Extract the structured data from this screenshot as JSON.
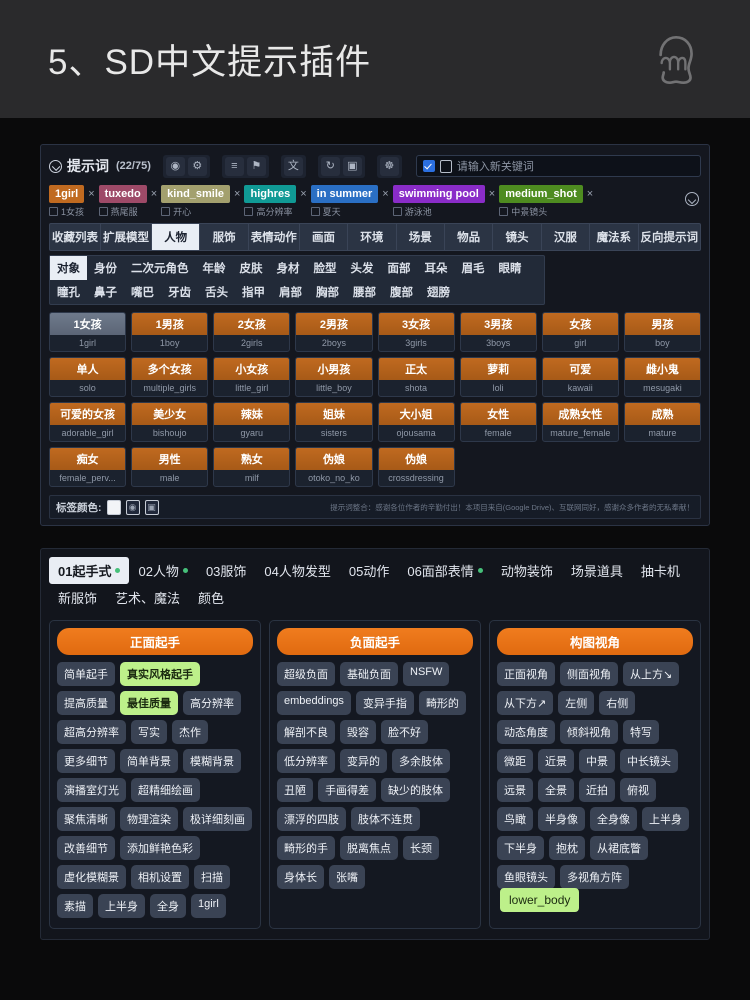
{
  "header": {
    "title": "5、SD中文提示插件",
    "hand_icon": "pointing-hand-icon"
  },
  "panel1": {
    "title": "提示词",
    "count": "(22/75)",
    "chevron_icon": "chevron-down-circle-icon",
    "toolbar_icons": [
      {
        "name": "globe-icon",
        "glyph": "⊕"
      },
      {
        "name": "gear-icon",
        "glyph": "⚙"
      },
      {
        "name": "list-doc-icon",
        "glyph": "≣"
      },
      {
        "name": "bookmark-icon",
        "glyph": "⚑"
      },
      {
        "name": "translate-icon",
        "glyph": "文"
      },
      {
        "name": "refresh-icon",
        "glyph": "↻"
      },
      {
        "name": "trash-icon",
        "glyph": "Ὕ1"
      },
      {
        "name": "settings-icon",
        "glyph": "☸"
      }
    ],
    "search": {
      "checkbox_checked": true,
      "placeholder": "请输入新关键词"
    },
    "chips": [
      {
        "en": "1girl",
        "cn": "1女孩",
        "color": "#c06a20",
        "close": "×"
      },
      {
        "en": "tuxedo",
        "cn": "燕尾服",
        "color": "#9e4a68",
        "close": "×"
      },
      {
        "en": "kind_smile",
        "cn": "开心",
        "color": "#a3a06e",
        "close": "×"
      },
      {
        "en": "highres",
        "cn": "高分辨率",
        "color": "#109a95",
        "close": "×"
      },
      {
        "en": "in summer",
        "cn": "夏天",
        "color": "#2a6fc4",
        "close": "×"
      },
      {
        "en": "swimming pool",
        "cn": "游泳池",
        "color": "#8a2cc8",
        "close": "×"
      },
      {
        "en": "medium_shot",
        "cn": "中景镜头",
        "color": "#4e8c20",
        "close": "×"
      }
    ],
    "category_tabs": [
      {
        "label": "收藏列表",
        "active": false
      },
      {
        "label": "扩展模型",
        "active": false
      },
      {
        "label": "人物",
        "active": true
      },
      {
        "label": "服饰",
        "active": false
      },
      {
        "label": "表情动作",
        "active": false
      },
      {
        "label": "画面",
        "active": false
      },
      {
        "label": "环境",
        "active": false
      },
      {
        "label": "场景",
        "active": false
      },
      {
        "label": "物品",
        "active": false
      },
      {
        "label": "镜头",
        "active": false
      },
      {
        "label": "汉服",
        "active": false
      },
      {
        "label": "魔法系",
        "active": false
      },
      {
        "label": "反向提示词",
        "active": false
      }
    ],
    "sub_tabs": [
      {
        "label": "对象",
        "active": true
      },
      {
        "label": "身份",
        "active": false
      },
      {
        "label": "二次元角色",
        "active": false
      },
      {
        "label": "年龄",
        "active": false
      },
      {
        "label": "皮肤",
        "active": false
      },
      {
        "label": "身材",
        "active": false
      },
      {
        "label": "脸型",
        "active": false
      },
      {
        "label": "头发",
        "active": false
      },
      {
        "label": "面部",
        "active": false
      },
      {
        "label": "耳朵",
        "active": false
      },
      {
        "label": "眉毛",
        "active": false
      },
      {
        "label": "眼睛",
        "active": false
      },
      {
        "label": "瞳孔",
        "active": false
      },
      {
        "label": "鼻子",
        "active": false
      },
      {
        "label": "嘴巴",
        "active": false
      },
      {
        "label": "牙齿",
        "active": false
      },
      {
        "label": "舌头",
        "active": false
      },
      {
        "label": "指甲",
        "active": false
      },
      {
        "label": "肩部",
        "active": false
      },
      {
        "label": "胸部",
        "active": false
      },
      {
        "label": "腰部",
        "active": false
      },
      {
        "label": "腹部",
        "active": false
      },
      {
        "label": "翅膀",
        "active": false
      }
    ],
    "tags": [
      {
        "cn": "1女孩",
        "en": "1girl",
        "selected": true
      },
      {
        "cn": "1男孩",
        "en": "1boy",
        "selected": false
      },
      {
        "cn": "2女孩",
        "en": "2girls",
        "selected": false
      },
      {
        "cn": "2男孩",
        "en": "2boys",
        "selected": false
      },
      {
        "cn": "3女孩",
        "en": "3girls",
        "selected": false
      },
      {
        "cn": "3男孩",
        "en": "3boys",
        "selected": false
      },
      {
        "cn": "女孩",
        "en": "girl",
        "selected": false
      },
      {
        "cn": "男孩",
        "en": "boy",
        "selected": false
      },
      {
        "cn": "单人",
        "en": "solo",
        "selected": false
      },
      {
        "cn": "多个女孩",
        "en": "multiple_girls",
        "selected": false
      },
      {
        "cn": "小女孩",
        "en": "little_girl",
        "selected": false
      },
      {
        "cn": "小男孩",
        "en": "little_boy",
        "selected": false
      },
      {
        "cn": "正太",
        "en": "shota",
        "selected": false
      },
      {
        "cn": "萝莉",
        "en": "loli",
        "selected": false
      },
      {
        "cn": "可爱",
        "en": "kawaii",
        "selected": false
      },
      {
        "cn": "雌小鬼",
        "en": "mesugaki",
        "selected": false
      },
      {
        "cn": "可爱的女孩",
        "en": "adorable_girl",
        "selected": false
      },
      {
        "cn": "美少女",
        "en": "bishoujo",
        "selected": false
      },
      {
        "cn": "辣妹",
        "en": "gyaru",
        "selected": false
      },
      {
        "cn": "姐妹",
        "en": "sisters",
        "selected": false
      },
      {
        "cn": "大小姐",
        "en": "ojousama",
        "selected": false
      },
      {
        "cn": "女性",
        "en": "female",
        "selected": false
      },
      {
        "cn": "成熟女性",
        "en": "mature_female",
        "selected": false
      },
      {
        "cn": "成熟",
        "en": "mature",
        "selected": false
      },
      {
        "cn": "痴女",
        "en": "female_perv...",
        "selected": false
      },
      {
        "cn": "男性",
        "en": "male",
        "selected": false
      },
      {
        "cn": "熟女",
        "en": "milf",
        "selected": false
      },
      {
        "cn": "伪娘",
        "en": "otoko_no_ko",
        "selected": false
      },
      {
        "cn": "伪娘",
        "en": "crossdressing",
        "selected": false
      }
    ],
    "footer": {
      "label": "标签颜色:",
      "swatches": [
        "white-swatch",
        "reset-swatch",
        "lock-swatch"
      ],
      "note": "提示词整合：感谢各位作者的辛勤付出！本项目来自(Google Drive)、互联网同好，感谢众多作者的无私奉献！"
    }
  },
  "panel2": {
    "tabs": [
      {
        "label": "01起手式",
        "active": true,
        "dot": true
      },
      {
        "label": "02人物",
        "active": false,
        "dot": true
      },
      {
        "label": "03服饰",
        "active": false,
        "dot": false
      },
      {
        "label": "04人物发型",
        "active": false,
        "dot": false
      },
      {
        "label": "05动作",
        "active": false,
        "dot": false
      },
      {
        "label": "06面部表情",
        "active": false,
        "dot": true
      },
      {
        "label": "动物装饰",
        "active": false,
        "dot": false
      },
      {
        "label": "场景道具",
        "active": false,
        "dot": false
      },
      {
        "label": "抽卡机",
        "active": false,
        "dot": false
      },
      {
        "label": "新服饰",
        "active": false,
        "dot": false
      },
      {
        "label": "艺术、魔法",
        "active": false,
        "dot": false
      },
      {
        "label": "颜色",
        "active": false,
        "dot": false
      }
    ],
    "columns": [
      {
        "header": "正面起手",
        "items": [
          {
            "label": "简单起手",
            "highlight": false
          },
          {
            "label": "真实风格起手",
            "highlight": true
          },
          {
            "label": "提高质量",
            "highlight": false
          },
          {
            "label": "最佳质量",
            "highlight": true
          },
          {
            "label": "高分辨率",
            "highlight": false
          },
          {
            "label": "超高分辨率",
            "highlight": false
          },
          {
            "label": "写实",
            "highlight": false
          },
          {
            "label": "杰作",
            "highlight": false
          },
          {
            "label": "更多细节",
            "highlight": false
          },
          {
            "label": "简单背景",
            "highlight": false
          },
          {
            "label": "模糊背景",
            "highlight": false
          },
          {
            "label": "演播室灯光",
            "highlight": false
          },
          {
            "label": "超精细绘画",
            "highlight": false
          },
          {
            "label": "聚焦清晰",
            "highlight": false
          },
          {
            "label": "物理渲染",
            "highlight": false
          },
          {
            "label": "极详细刻画",
            "highlight": false
          },
          {
            "label": "改善细节",
            "highlight": false
          },
          {
            "label": "添加鲜艳色彩",
            "highlight": false
          },
          {
            "label": "虚化模糊景",
            "highlight": false
          },
          {
            "label": "相机设置",
            "highlight": false
          },
          {
            "label": "扫描",
            "highlight": false
          },
          {
            "label": "素描",
            "highlight": false
          },
          {
            "label": "上半身",
            "highlight": false
          },
          {
            "label": "全身",
            "highlight": false
          },
          {
            "label": "1girl",
            "highlight": false
          }
        ]
      },
      {
        "header": "负面起手",
        "items": [
          {
            "label": "超级负面",
            "highlight": false
          },
          {
            "label": "基础负面",
            "highlight": false
          },
          {
            "label": "NSFW",
            "highlight": false
          },
          {
            "label": "embeddings",
            "highlight": false
          },
          {
            "label": "变异手指",
            "highlight": false
          },
          {
            "label": "畸形的",
            "highlight": false
          },
          {
            "label": "解剖不良",
            "highlight": false
          },
          {
            "label": "毁容",
            "highlight": false
          },
          {
            "label": "脸不好",
            "highlight": false
          },
          {
            "label": "低分辨率",
            "highlight": false
          },
          {
            "label": "变异的",
            "highlight": false
          },
          {
            "label": "多余肢体",
            "highlight": false
          },
          {
            "label": "丑陋",
            "highlight": false
          },
          {
            "label": "手画得差",
            "highlight": false
          },
          {
            "label": "缺少的肢体",
            "highlight": false
          },
          {
            "label": "漂浮的四肢",
            "highlight": false
          },
          {
            "label": "肢体不连贯",
            "highlight": false
          },
          {
            "label": "畸形的手",
            "highlight": false
          },
          {
            "label": "脱离焦点",
            "highlight": false
          },
          {
            "label": "长颈",
            "highlight": false
          },
          {
            "label": "身体长",
            "highlight": false
          },
          {
            "label": "张嘴",
            "highlight": false
          }
        ]
      },
      {
        "header": "构图视角",
        "items": [
          {
            "label": "正面视角",
            "highlight": false
          },
          {
            "label": "侧面视角",
            "highlight": false
          },
          {
            "label": "从上方↘",
            "highlight": false
          },
          {
            "label": "从下方↗",
            "highlight": false
          },
          {
            "label": "左侧",
            "highlight": false
          },
          {
            "label": "右侧",
            "highlight": false
          },
          {
            "label": "动态角度",
            "highlight": false
          },
          {
            "label": "倾斜视角",
            "highlight": false
          },
          {
            "label": "特写",
            "highlight": false
          },
          {
            "label": "微距",
            "highlight": false
          },
          {
            "label": "近景",
            "highlight": false
          },
          {
            "label": "中景",
            "highlight": false
          },
          {
            "label": "中长镜头",
            "highlight": false
          },
          {
            "label": "远景",
            "highlight": false
          },
          {
            "label": "全景",
            "highlight": false
          },
          {
            "label": "近拍",
            "highlight": false
          },
          {
            "label": "俯视",
            "highlight": false
          },
          {
            "label": "鸟瞰",
            "highlight": false
          },
          {
            "label": "半身像",
            "highlight": false
          },
          {
            "label": "全身像",
            "highlight": false
          },
          {
            "label": "上半身",
            "highlight": false
          },
          {
            "label": "下半身",
            "highlight": false
          },
          {
            "label": "抱枕",
            "highlight": false
          },
          {
            "label": "从裙底瞥",
            "highlight": false
          },
          {
            "label": "鱼眼镜头",
            "highlight": false
          },
          {
            "label": "多视角方阵",
            "highlight": false
          }
        ],
        "tooltip": "lower_body"
      }
    ]
  }
}
